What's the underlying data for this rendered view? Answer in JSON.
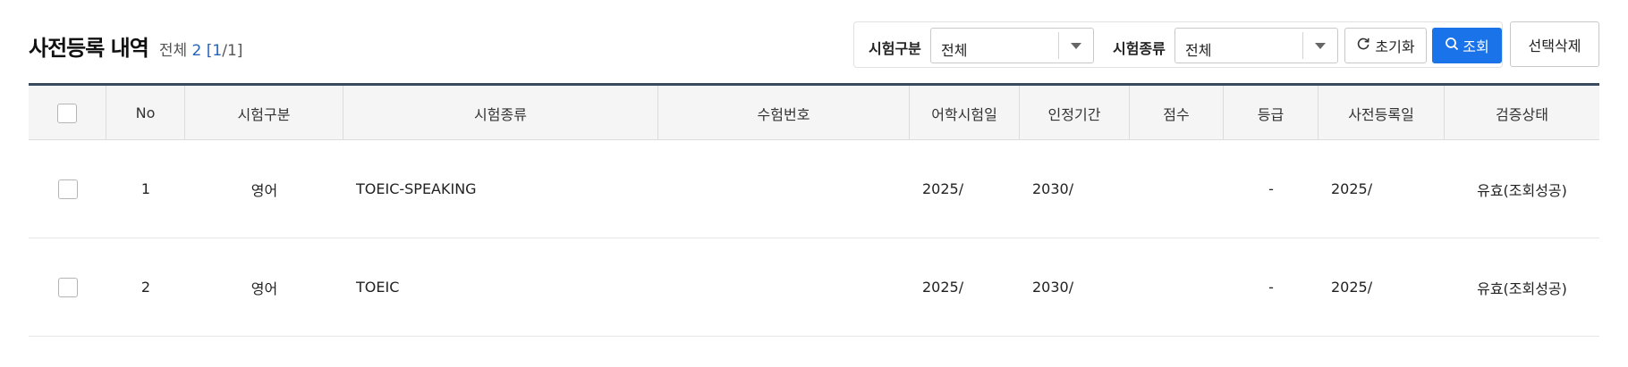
{
  "header": {
    "title": "사전등록 내역",
    "count_label": "전체",
    "total": "2",
    "page_open": "[",
    "page_current": "1",
    "page_sep": "/",
    "page_total": "1",
    "page_close": "]"
  },
  "filters": {
    "exam_category_label": "시험구분",
    "exam_category_value": "전체",
    "exam_type_label": "시험종류",
    "exam_type_value": "전체",
    "reset_label": "초기화",
    "search_label": "조회"
  },
  "actions": {
    "delete_label": "선택삭제"
  },
  "table": {
    "columns": [
      "No",
      "시험구분",
      "시험종류",
      "수험번호",
      "어학시험일",
      "인정기간",
      "점수",
      "등급",
      "사전등록일",
      "검증상태"
    ],
    "rows": [
      {
        "no": "1",
        "category": "영어",
        "type": "TOEIC-SPEAKING",
        "exam_no": "",
        "exam_date": "2025/",
        "valid_period": "2030/",
        "score": "",
        "grade": "-",
        "reg_date": "2025/",
        "status": "유효(조회성공)"
      },
      {
        "no": "2",
        "category": "영어",
        "type": "TOEIC",
        "exam_no": "",
        "exam_date": "2025/",
        "valid_period": "2030/",
        "score": "",
        "grade": "-",
        "reg_date": "2025/",
        "status": "유효(조회성공)"
      }
    ]
  },
  "colors": {
    "accent": "#1a73e8",
    "header_border": "#3a4a5e",
    "count_number": "#2563b8"
  },
  "icons": {
    "reset": "refresh-icon",
    "search": "search-icon",
    "dropdown": "chevron-down-icon"
  }
}
